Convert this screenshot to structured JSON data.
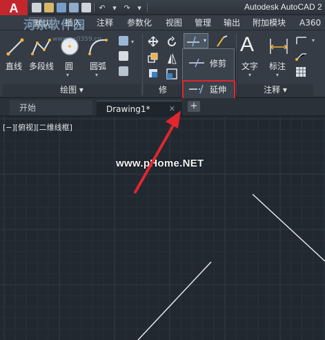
{
  "titlebar": {
    "logo": "A",
    "app_title": "Autodesk AutoCAD 2",
    "qat_undo": "↶",
    "qat_redo": "↷",
    "qat_more": "▾"
  },
  "ribbon_tabs": {
    "tab_default": "默认",
    "tab_insert": "插入",
    "tab_annotate": "注释",
    "tab_parametric": "参数化",
    "tab_view": "视图",
    "tab_manage": "管理",
    "tab_output": "输出",
    "tab_addins": "附加模块",
    "tab_a360": "A360"
  },
  "draw_panel": {
    "line": "直线",
    "polyline": "多段线",
    "circle": "圆",
    "arc": "圆弧",
    "footer": "绘图 ▾"
  },
  "modify_panel": {
    "footer_partial": "修"
  },
  "flyout": {
    "trim": "修剪",
    "extend": "延伸"
  },
  "annotation_panel": {
    "text": "文字",
    "dimension": "标注",
    "footer": "注释 ▾"
  },
  "file_tabs": {
    "start": "开始",
    "drawing": "Drawing1*",
    "close": "✕",
    "add": "+"
  },
  "viewport": {
    "label": "[−][俯视][二维线框]"
  },
  "watermarks": {
    "url": "www.pHome.NET",
    "cn": "河东软件园",
    "small_url": "www.pc0359.cn"
  },
  "colors": {
    "highlight_red": "#e1262e",
    "logo_red": "#c4262e",
    "canvas_bg": "#212830",
    "grid_line": "#2b333c",
    "drawn_line": "#e6e9ec"
  }
}
